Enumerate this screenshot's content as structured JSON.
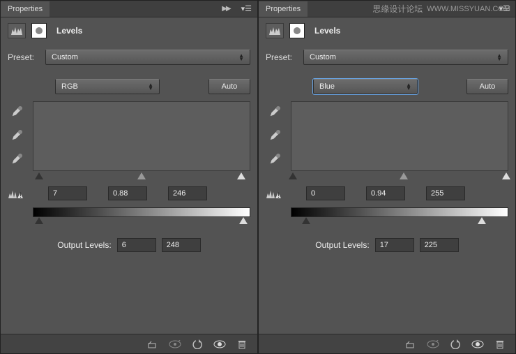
{
  "watermark": {
    "zh": "思缘设计论坛",
    "en": "WWW.MISSYUAN.COM"
  },
  "left": {
    "tab": "Properties",
    "title": "Levels",
    "presetLabel": "Preset:",
    "preset": "Custom",
    "channel": "RGB",
    "autoLabel": "Auto",
    "inputBlack": "7",
    "inputGamma": "0.88",
    "inputWhite": "246",
    "outputLabel": "Output Levels:",
    "outputBlack": "6",
    "outputWhite": "248"
  },
  "right": {
    "tab": "Properties",
    "title": "Levels",
    "presetLabel": "Preset:",
    "preset": "Custom",
    "channel": "Blue",
    "autoLabel": "Auto",
    "inputBlack": "0",
    "inputGamma": "0.94",
    "inputWhite": "255",
    "outputLabel": "Output Levels:",
    "outputBlack": "17",
    "outputWhite": "225"
  }
}
